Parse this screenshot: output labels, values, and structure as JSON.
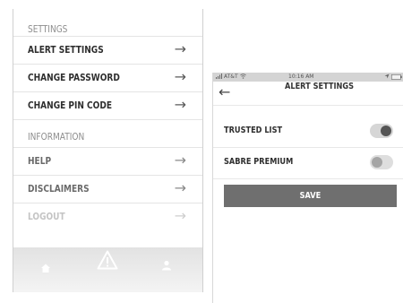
{
  "left_screen": {
    "settings_header": "SETTINGS",
    "settings_items": [
      {
        "label": "ALERT SETTINGS"
      },
      {
        "label": "CHANGE PASSWORD"
      },
      {
        "label": "CHANGE PIN CODE"
      }
    ],
    "information_header": "INFORMATION",
    "information_items": [
      {
        "label": "HELP"
      },
      {
        "label": "DISCLAIMERS"
      },
      {
        "label": "LOGOUT"
      }
    ],
    "arrow_glyph": "→",
    "tab_bar": {
      "icons": [
        "home-icon",
        "warning-icon",
        "person-icon"
      ]
    }
  },
  "right_screen": {
    "status_bar": {
      "carrier": "AT&T",
      "time": "10:16 AM"
    },
    "title": "ALERT SETTINGS",
    "back_glyph": "←",
    "toggles": [
      {
        "label": "TRUSTED LIST",
        "on": true
      },
      {
        "label": "SABRE PREMIUM",
        "on": false
      }
    ],
    "save_label": "SAVE"
  },
  "colors": {
    "save_button": "#6f6f6f",
    "toggle_knob_on": "#555555",
    "toggle_knob_off": "#a5a5a5"
  }
}
